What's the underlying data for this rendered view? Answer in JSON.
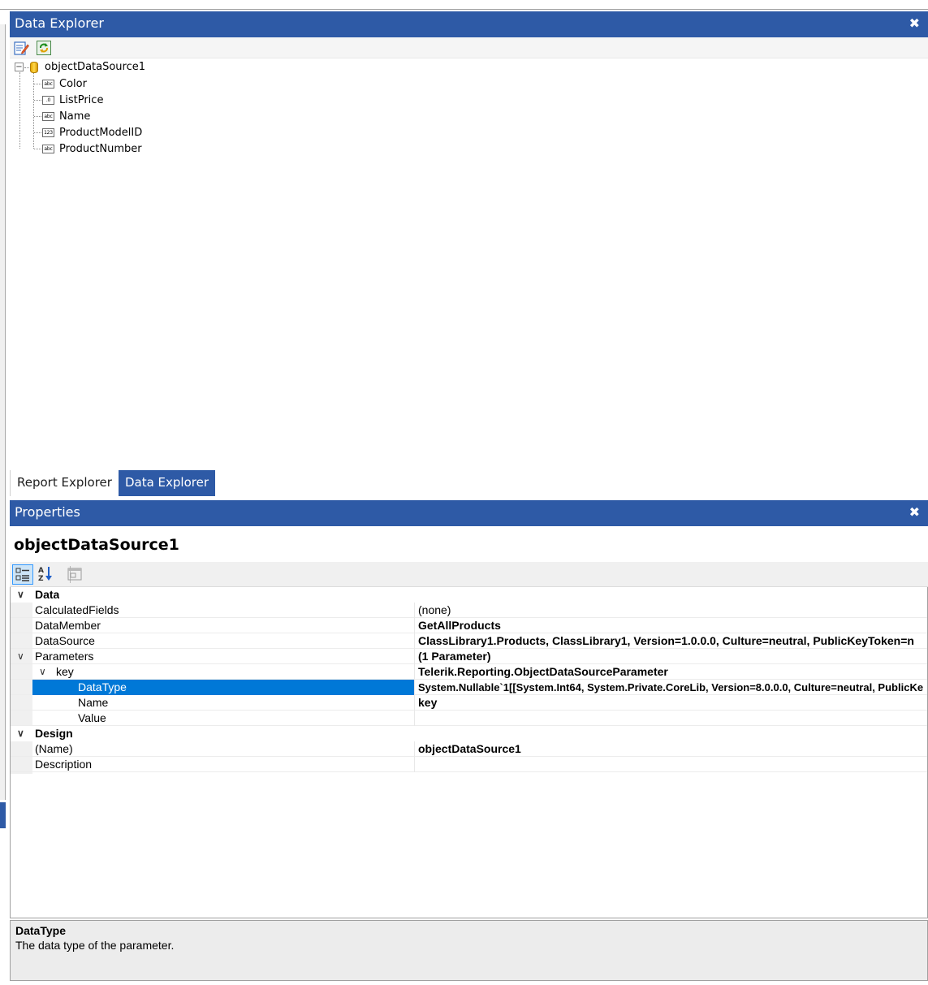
{
  "data_explorer": {
    "title": "Data Explorer",
    "close_glyph": "✖",
    "toolbar": {
      "edit_icon": "edit-datasource-icon",
      "refresh_icon": "refresh-icon"
    },
    "tree": {
      "root": {
        "label": "objectDataSource1",
        "expander": "−",
        "icon": "database-icon"
      },
      "fields": [
        {
          "label": "Color",
          "type_badge": "abc"
        },
        {
          "label": "ListPrice",
          "type_badge": ".0"
        },
        {
          "label": "Name",
          "type_badge": "abc"
        },
        {
          "label": "ProductModelID",
          "type_badge": "123"
        },
        {
          "label": "ProductNumber",
          "type_badge": "abc"
        }
      ]
    }
  },
  "tabs": [
    {
      "label": "Report Explorer",
      "active": false
    },
    {
      "label": "Data Explorer",
      "active": true
    }
  ],
  "properties": {
    "title": "Properties",
    "close_glyph": "✖",
    "object_name": "objectDataSource1",
    "toolbar": {
      "categorized_icon": "categorized-icon",
      "alphabetical_icon": "alphabetical-sort-icon",
      "property_pages_icon": "property-pages-icon"
    },
    "rows": [
      {
        "kind": "category",
        "chevron": "∨",
        "name": "Data",
        "value": ""
      },
      {
        "kind": "prop",
        "name": "CalculatedFields",
        "value": "(none)",
        "bold": false
      },
      {
        "kind": "prop",
        "name": "DataMember",
        "value": "GetAllProducts",
        "bold": true
      },
      {
        "kind": "prop",
        "name": "DataSource",
        "value": "ClassLibrary1.Products, ClassLibrary1, Version=1.0.0.0, Culture=neutral, PublicKeyToken=n",
        "bold": true
      },
      {
        "kind": "prop",
        "name": "Parameters",
        "value": "(1 Parameter)",
        "bold": true,
        "chevron": "∨"
      },
      {
        "kind": "prop",
        "name": "key",
        "value": "Telerik.Reporting.ObjectDataSourceParameter",
        "bold": true,
        "chevron": "∨",
        "indent": 1
      },
      {
        "kind": "prop",
        "name": "DataType",
        "value": "System.Nullable`1[[System.Int64, System.Private.CoreLib, Version=8.0.0.0, Culture=neutral, PublicKe",
        "bold": true,
        "indent": 2,
        "selected": true
      },
      {
        "kind": "prop",
        "name": "Name",
        "value": "key",
        "bold": true,
        "indent": 2
      },
      {
        "kind": "prop",
        "name": "Value",
        "value": "",
        "bold": false,
        "indent": 2
      },
      {
        "kind": "category",
        "chevron": "∨",
        "name": "Design",
        "value": ""
      },
      {
        "kind": "prop",
        "name": "(Name)",
        "value": "objectDataSource1",
        "bold": true
      },
      {
        "kind": "prop",
        "name": "Description",
        "value": "",
        "bold": false
      }
    ],
    "description": {
      "title": "DataType",
      "text": "The data type of the parameter."
    }
  },
  "colors": {
    "header_blue": "#2e5aa6",
    "selection_blue": "#0078d7"
  }
}
